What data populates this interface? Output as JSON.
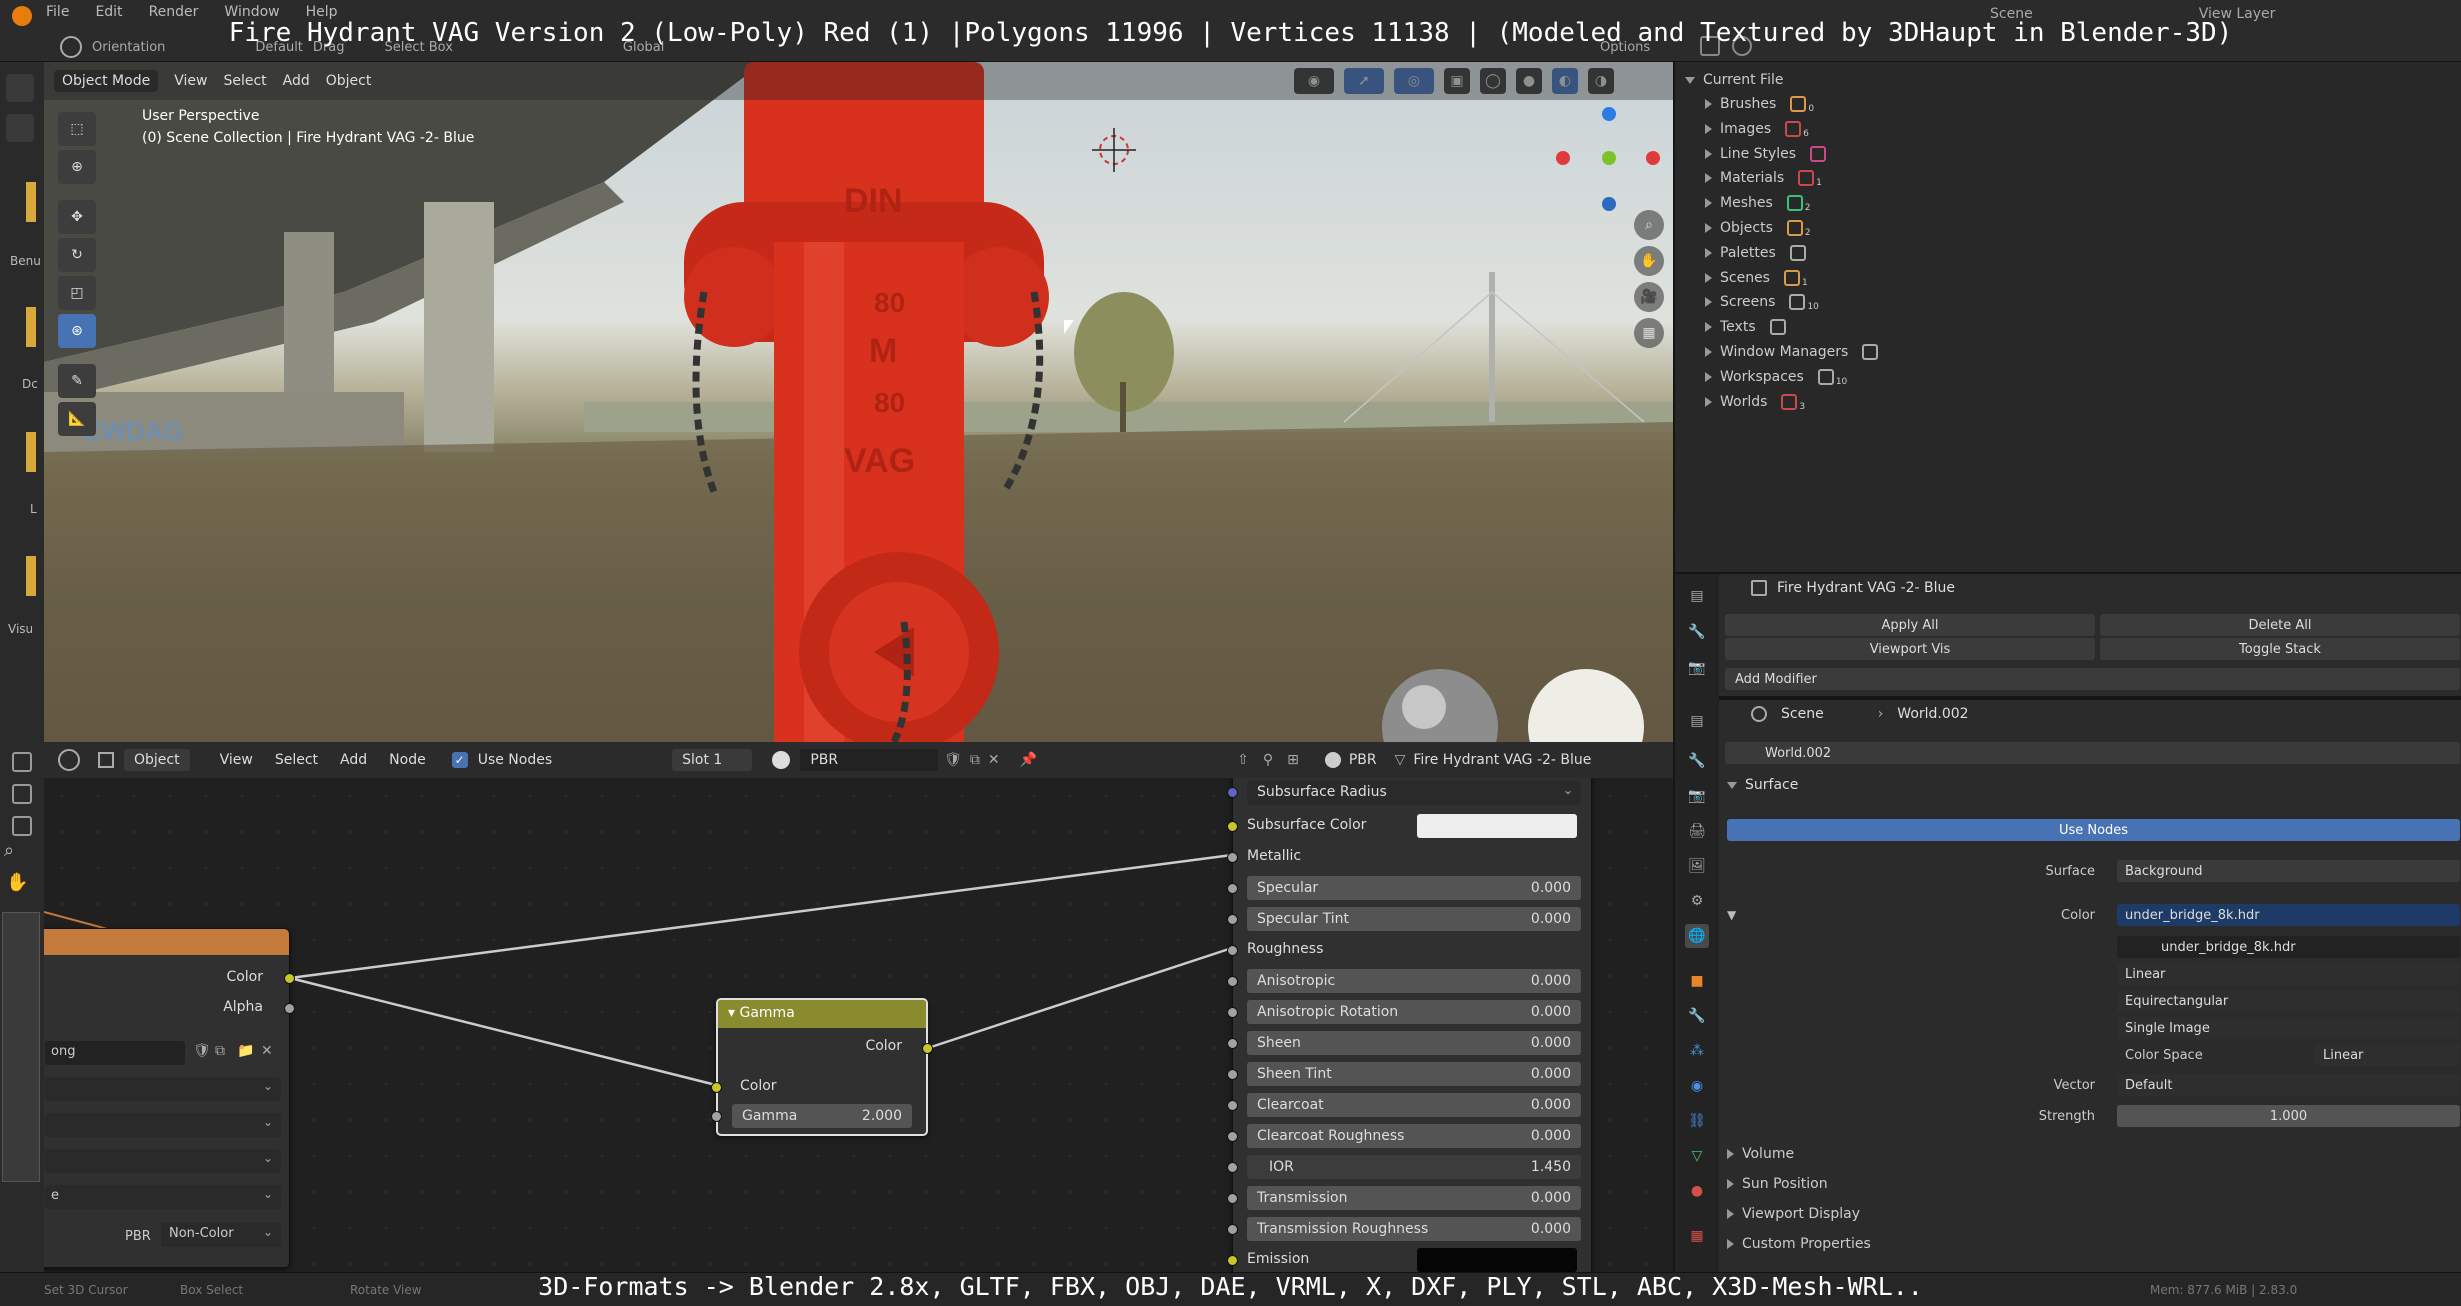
{
  "overlay": {
    "title": "Fire Hydrant VAG Version 2 (Low-Poly) Red (1) |Polygons 11996 | Vertices 11138 | (Modeled and Textured by 3DHaupt in Blender-3D)",
    "footer": "3D-Formats -> Blender 2.8x, GLTF, FBX, OBJ, DAE, VRML, X, DXF, PLY, STL, ABC, X3D-Mesh-WRL.."
  },
  "topbar": {
    "menus": [
      "File",
      "Edit",
      "Render",
      "Window",
      "Help"
    ],
    "orientation": "Orientation",
    "default": "Default",
    "drag": "Drag",
    "select_box": "Select Box",
    "global": "Global",
    "options": "Options",
    "scene": "Scene",
    "view_layer": "View Layer"
  },
  "viewport": {
    "mode": "Object Mode",
    "menus": [
      "View",
      "Select",
      "Add",
      "Object"
    ],
    "perspective": "User Perspective",
    "collection": "(0) Scene Collection | Fire Hydrant VAG -2- Blue",
    "left_labels": [
      "Benu",
      "Dc",
      "L",
      "Visu"
    ],
    "hydrant_text": [
      "DIN",
      "80",
      "M",
      "80",
      "VAG"
    ],
    "graffiti": "EWDAG"
  },
  "outliner": {
    "root": "Current File",
    "items": [
      {
        "label": "Brushes",
        "count": "0"
      },
      {
        "label": "Images",
        "count": "6"
      },
      {
        "label": "Line Styles",
        "count": ""
      },
      {
        "label": "Materials",
        "count": "1"
      },
      {
        "label": "Meshes",
        "count": "2"
      },
      {
        "label": "Objects",
        "count": "2"
      },
      {
        "label": "Palettes",
        "count": ""
      },
      {
        "label": "Scenes",
        "count": "1"
      },
      {
        "label": "Screens",
        "count": "10"
      },
      {
        "label": "Texts",
        "count": ""
      },
      {
        "label": "Window Managers",
        "count": ""
      },
      {
        "label": "Workspaces",
        "count": "10"
      },
      {
        "label": "Worlds",
        "count": "3"
      }
    ]
  },
  "modifiers": {
    "object": "Fire Hydrant VAG -2- Blue",
    "apply_all": "Apply All",
    "delete_all": "Delete All",
    "viewport_vis": "Viewport Vis",
    "toggle_stack": "Toggle Stack",
    "add_modifier": "Add Modifier"
  },
  "world": {
    "scene": "Scene",
    "world_name": "World.002",
    "world_field": "World.002",
    "surface": "Surface",
    "use_nodes": "Use Nodes",
    "surface_label": "Surface",
    "surface_value": "Background",
    "color_label": "Color",
    "color_value": "under_bridge_8k.hdr",
    "image_field": "under_bridge_8k.hdr",
    "interp": "Linear",
    "projection": "Equirectangular",
    "source": "Single Image",
    "color_space_label": "Color Space",
    "color_space_value": "Linear",
    "vector_label": "Vector",
    "vector_value": "Default",
    "strength_label": "Strength",
    "strength_value": "1.000",
    "panels": [
      "Volume",
      "Sun Position",
      "Viewport Display",
      "Custom Properties"
    ]
  },
  "node_editor": {
    "type": "Object",
    "menus": [
      "View",
      "Select",
      "Add",
      "Node"
    ],
    "use_nodes": "Use Nodes",
    "slot": "Slot 1",
    "material": "PBR",
    "breadcrumb_mat": "PBR",
    "breadcrumb_obj": "Fire Hydrant VAG -2- Blue"
  },
  "image_node": {
    "out_color": "Color",
    "out_alpha": "Alpha",
    "image_name": "ong",
    "field4": "e",
    "label_pbr": "PBR",
    "colorspace": "Non-Color"
  },
  "gamma_node": {
    "title": "Gamma",
    "out_color": "Color",
    "in_color": "Color",
    "gamma_label": "Gamma",
    "gamma_value": "2.000"
  },
  "bsdf": {
    "subsurface_method": "Subsurface Radius",
    "rows": [
      {
        "label": "Subsurface Color",
        "value": "",
        "kind": "color-white",
        "sock": "y"
      },
      {
        "label": "Metallic",
        "value": "",
        "kind": "plain",
        "sock": "g"
      },
      {
        "label": "Specular",
        "value": "0.000",
        "kind": "slider",
        "sock": "g"
      },
      {
        "label": "Specular Tint",
        "value": "0.000",
        "kind": "slider",
        "sock": "g"
      },
      {
        "label": "Roughness",
        "value": "",
        "kind": "plain",
        "sock": "g"
      },
      {
        "label": "Anisotropic",
        "value": "0.000",
        "kind": "slider",
        "sock": "g"
      },
      {
        "label": "Anisotropic Rotation",
        "value": "0.000",
        "kind": "slider",
        "sock": "g"
      },
      {
        "label": "Sheen",
        "value": "0.000",
        "kind": "slider",
        "sock": "g"
      },
      {
        "label": "Sheen Tint",
        "value": "0.000",
        "kind": "slider",
        "sock": "g"
      },
      {
        "label": "Clearcoat",
        "value": "0.000",
        "kind": "slider",
        "sock": "g"
      },
      {
        "label": "Clearcoat Roughness",
        "value": "0.000",
        "kind": "slider",
        "sock": "g"
      },
      {
        "label": "IOR",
        "value": "1.450",
        "kind": "slider-ior",
        "sock": "g"
      },
      {
        "label": "Transmission",
        "value": "0.000",
        "kind": "slider",
        "sock": "g"
      },
      {
        "label": "Transmission Roughness",
        "value": "0.000",
        "kind": "slider",
        "sock": "g"
      },
      {
        "label": "Emission",
        "value": "",
        "kind": "color-black",
        "sock": "y"
      }
    ]
  },
  "statusbar": {
    "left": "Set 3D Cursor",
    "mid": "Box Select",
    "rotate": "Rotate View",
    "right": "Mem: 877.6 MiB | 2.83.0"
  },
  "colors": {
    "accent": "#4772b3",
    "hydrant_red": "#d8321f",
    "gamma_header": "#8a8a2e",
    "image_header": "#c47a3c"
  }
}
